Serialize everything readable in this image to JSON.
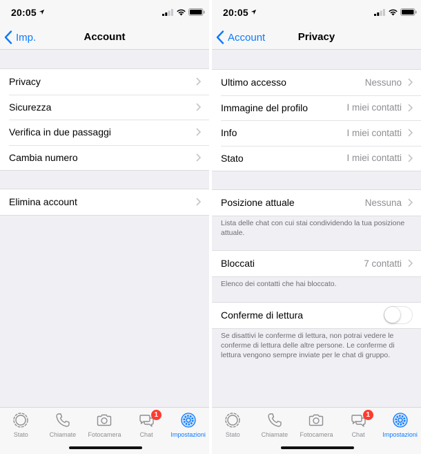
{
  "status_bar": {
    "time": "20:05"
  },
  "left": {
    "nav": {
      "back_label": "Imp.",
      "title": "Account"
    },
    "groups": [
      {
        "items": [
          {
            "label": "Privacy"
          },
          {
            "label": "Sicurezza"
          },
          {
            "label": "Verifica in due passaggi"
          },
          {
            "label": "Cambia numero"
          }
        ]
      },
      {
        "items": [
          {
            "label": "Elimina account"
          }
        ]
      }
    ]
  },
  "right": {
    "nav": {
      "back_label": "Account",
      "title": "Privacy"
    },
    "group1": [
      {
        "label": "Ultimo accesso",
        "value": "Nessuno"
      },
      {
        "label": "Immagine del profilo",
        "value": "I miei contatti"
      },
      {
        "label": "Info",
        "value": "I miei contatti"
      },
      {
        "label": "Stato",
        "value": "I miei contatti"
      }
    ],
    "location": {
      "label": "Posizione attuale",
      "value": "Nessuna",
      "footnote": "Lista delle chat con cui stai condividendo la tua posizione attuale."
    },
    "blocked": {
      "label": "Bloccati",
      "value": "7 contatti",
      "footnote": "Elenco dei contatti che hai bloccato."
    },
    "read_receipts": {
      "label": "Conferme di lettura",
      "enabled": false,
      "footnote": "Se disattivi le conferme di lettura, non potrai vedere le conferme di lettura delle altre persone. Le conferme di lettura vengono sempre inviate per le chat di gruppo."
    }
  },
  "tab_bar": {
    "tabs": [
      {
        "label": "Stato",
        "icon": "status-ring-icon"
      },
      {
        "label": "Chiamate",
        "icon": "phone-icon"
      },
      {
        "label": "Fotocamera",
        "icon": "camera-icon"
      },
      {
        "label": "Chat",
        "icon": "chat-bubbles-icon",
        "badge": "1"
      },
      {
        "label": "Impostazioni",
        "icon": "gear-icon",
        "active": true
      }
    ]
  },
  "colors": {
    "accent": "#0a7aff",
    "badge": "#ff3b30",
    "secondary_text": "#8e8e93",
    "background": "#efeff4"
  }
}
